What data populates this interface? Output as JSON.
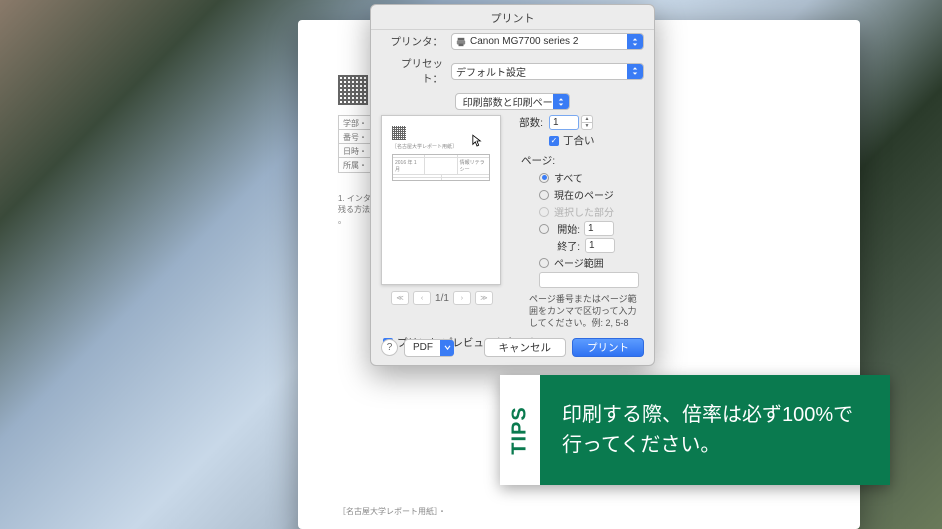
{
  "dialog": {
    "title": "プリント",
    "printer_label": "プリンタ：",
    "printer_value": "Canon MG7700 series 2",
    "preset_label": "プリセット：",
    "preset_value": "デフォルト設定",
    "section_value": "印刷部数と印刷ページ",
    "copies_label": "部数:",
    "copies_value": "1",
    "collate_label": "丁合い",
    "pages_heading": "ページ:",
    "radio_all": "すべて",
    "radio_current": "現在のページ",
    "radio_selection": "選択した部分",
    "from_label": "開始:",
    "from_value": "1",
    "to_label": "終了:",
    "to_value": "1",
    "radio_range": "ページ範囲",
    "range_hint": "ページ番号またはページ範囲をカンマで区切って入力してください。例: 2, 5-8",
    "page_indicator": "1/1",
    "show_preview": "プリント プレビューを表示する",
    "help": "?",
    "pdf_label": "PDF",
    "cancel": "キャンセル",
    "print": "プリント"
  },
  "doc": {
    "row1": "学部・",
    "row2": "番号・",
    "row3": "日時・",
    "row4": "所属・",
    "body1": "1. インタ",
    "body2": "残る方法",
    "body3": "。",
    "footer": "［名古屋大学レポート用紙］・"
  },
  "preview": {
    "title_text": "［名古屋大学レポート用紙］",
    "date_text": "2016 年 1 月",
    "name_text": "情報リテラシー"
  },
  "tips": {
    "tab": "TIPS",
    "text": "印刷する際、倍率は必ず100%で行ってください。"
  }
}
